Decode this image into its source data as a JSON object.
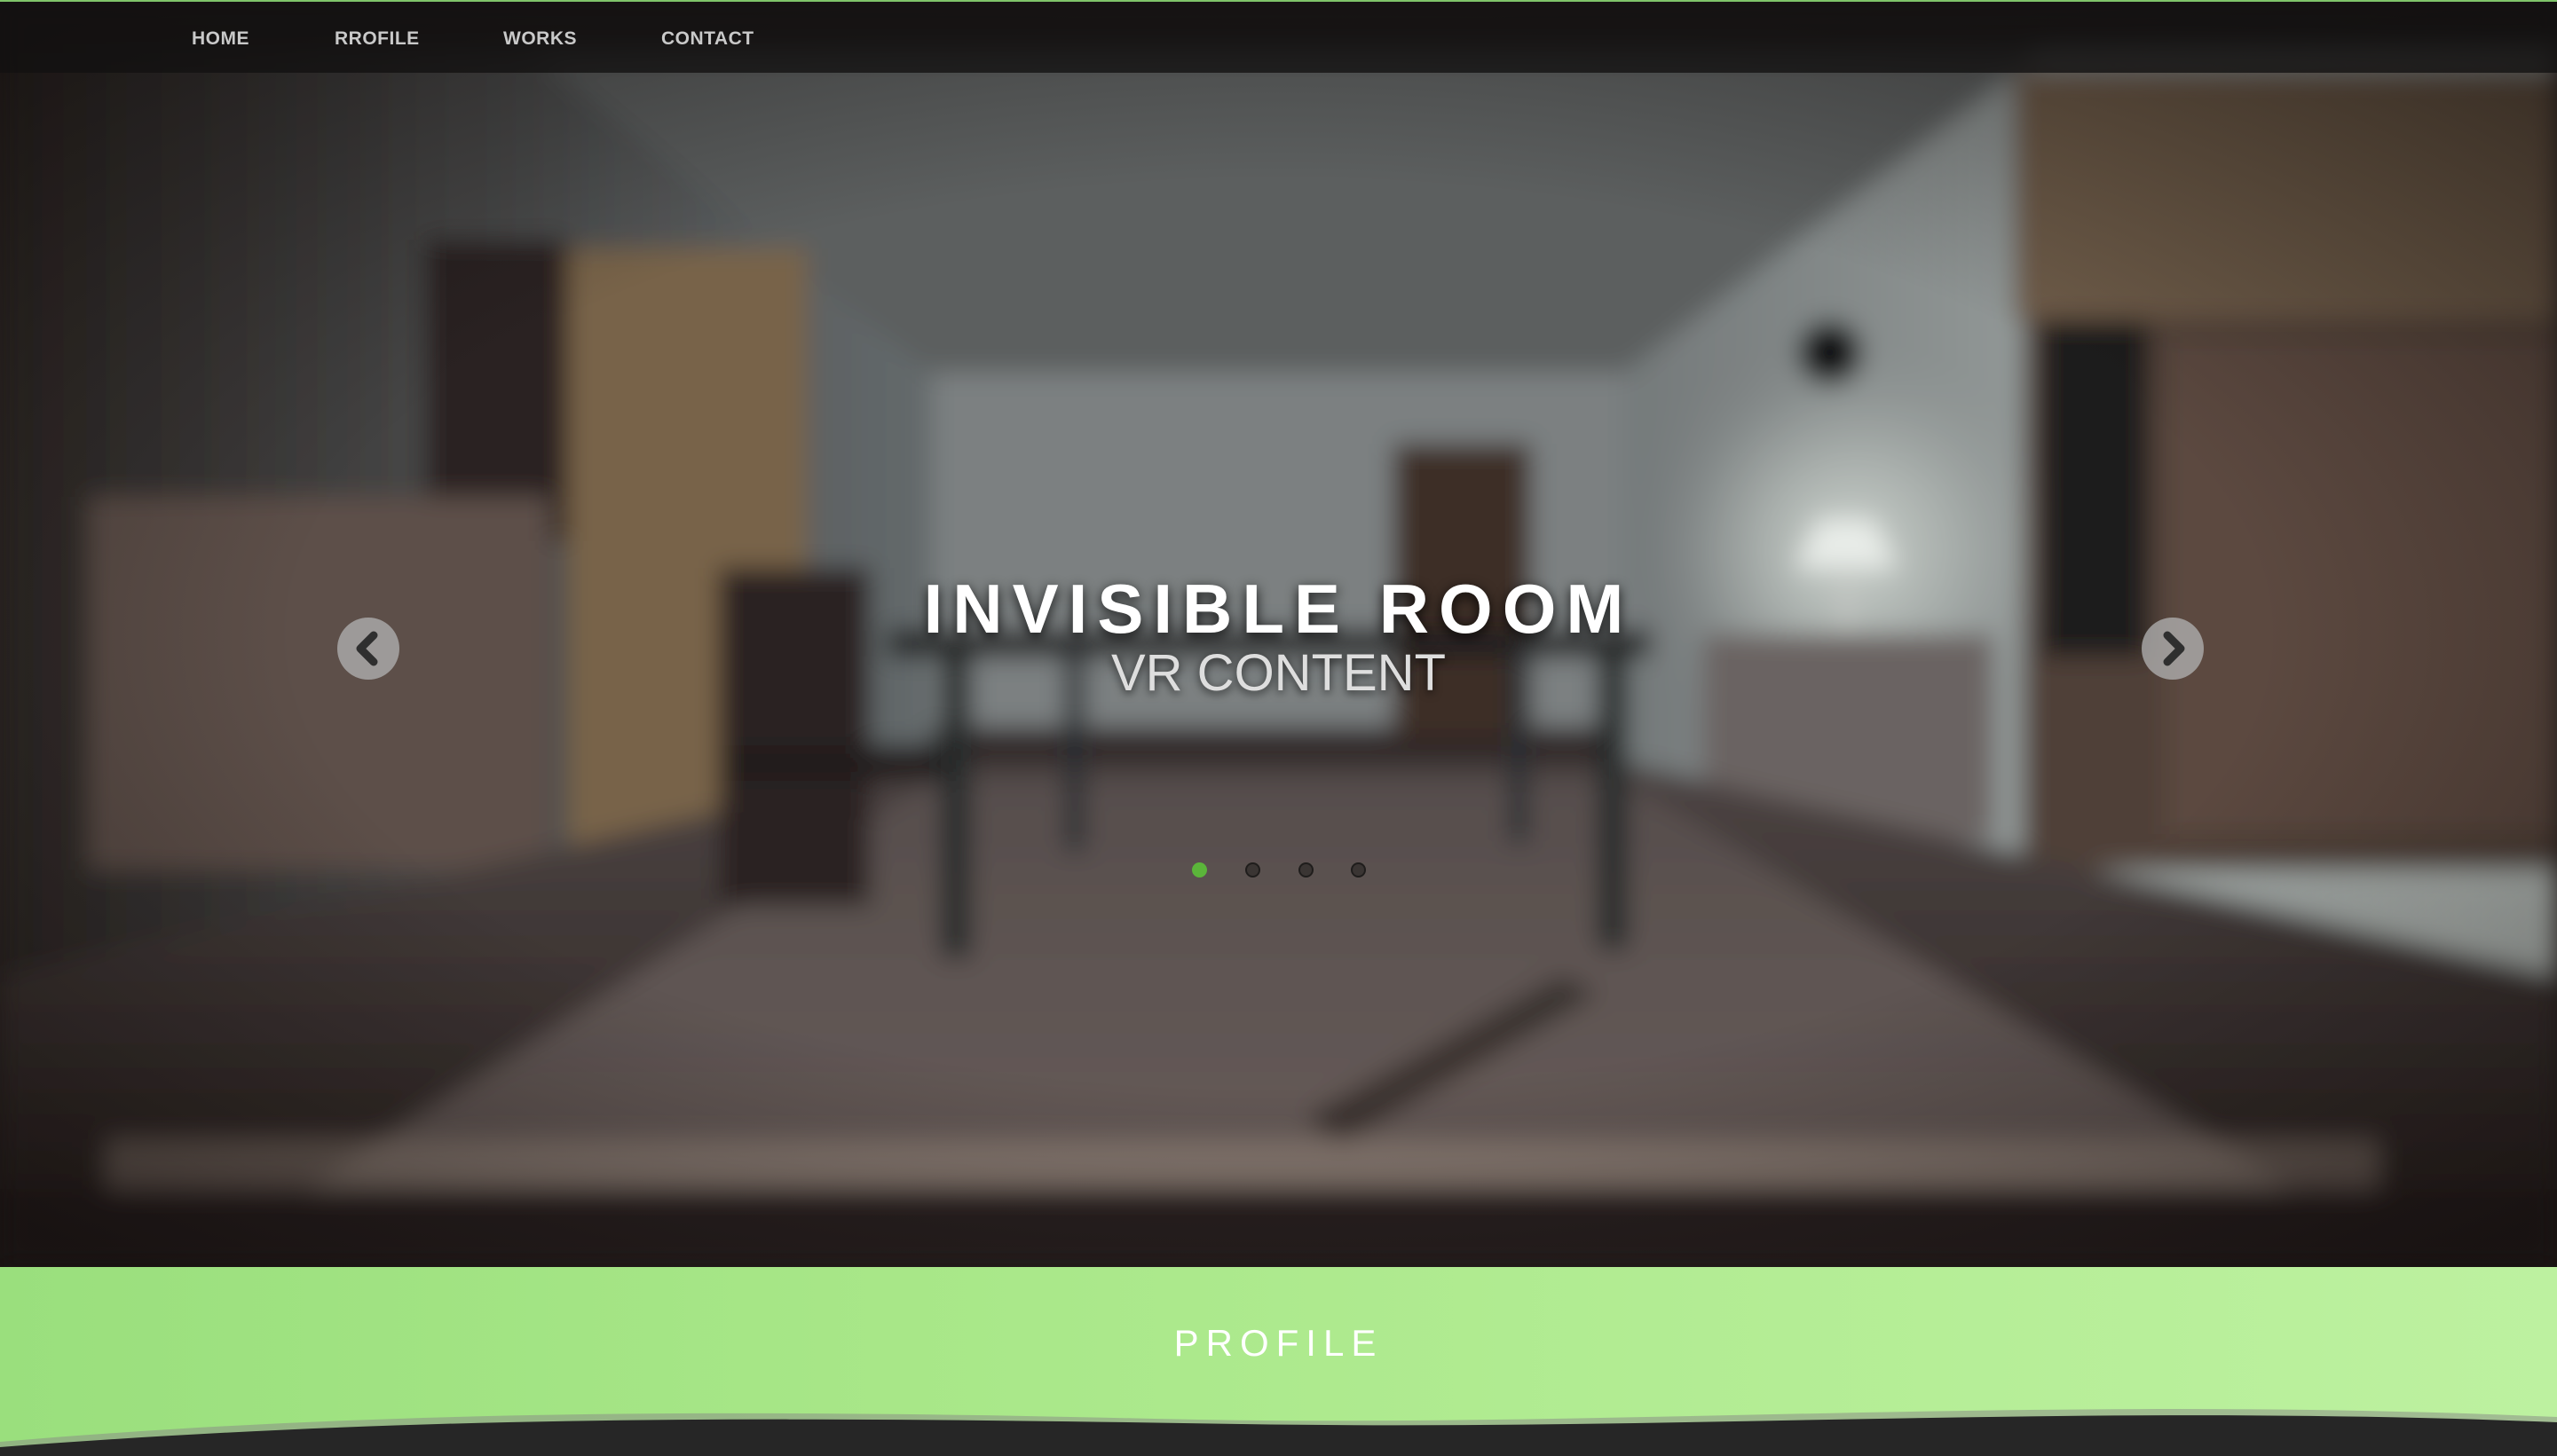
{
  "nav": {
    "items": [
      {
        "label": "HOME"
      },
      {
        "label": "RROFILE"
      },
      {
        "label": "WORKS"
      },
      {
        "label": "CONTACT"
      }
    ]
  },
  "slider": {
    "title": "INVISIBLE ROOM",
    "subtitle": "VR CONTENT",
    "prev_icon": "chevron-left-icon",
    "next_icon": "chevron-right-icon",
    "slide_count": 4,
    "active_slide": 1
  },
  "profile": {
    "heading": "PROFILE"
  },
  "colors": {
    "accent": "#5bb53a",
    "band_green": "#a8e788",
    "dark": "#262626",
    "nav_text": "#c9c9c9"
  }
}
